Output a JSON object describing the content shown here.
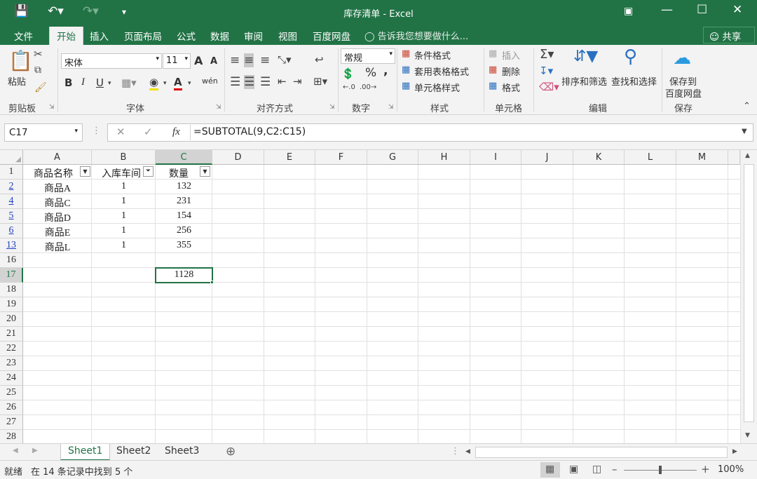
{
  "window": {
    "title": "库存清单 - Excel"
  },
  "ribbon_tabs": [
    "文件",
    "开始",
    "插入",
    "页面布局",
    "公式",
    "数据",
    "审阅",
    "视图",
    "百度网盘"
  ],
  "tell_me": "告诉我您想要做什么...",
  "share_label": "共享",
  "clipboard": {
    "paste": "粘贴",
    "group": "剪贴板"
  },
  "font": {
    "name": "宋体",
    "size": "11",
    "group": "字体",
    "bold": "B",
    "italic": "I",
    "underline": "U",
    "grow": "A",
    "shrink": "A",
    "wen": "wén"
  },
  "alignment": {
    "group": "对齐方式"
  },
  "number": {
    "format": "常规",
    "group": "数字",
    "percent": "%",
    "comma": ","
  },
  "styles": {
    "conditional": "条件格式",
    "table": "套用表格格式",
    "cell": "单元格样式",
    "group": "样式"
  },
  "cells": {
    "insert": "插入",
    "delete": "删除",
    "format": "格式",
    "group": "单元格"
  },
  "editing": {
    "sort": "排序和筛选",
    "find": "查找和选择",
    "group": "编辑"
  },
  "save_group": {
    "save": "保存到",
    "save2": "百度网盘",
    "group": "保存"
  },
  "formula_bar": {
    "name_box": "C17",
    "fx": "fx",
    "formula": "=SUBTOTAL(9,C2:C15)"
  },
  "columns": [
    "A",
    "B",
    "C",
    "D",
    "E",
    "F",
    "G",
    "H",
    "I",
    "J",
    "K",
    "L",
    "M"
  ],
  "rows": [
    "1",
    "2",
    "4",
    "5",
    "6",
    "13",
    "16",
    "17",
    "18",
    "19",
    "20",
    "21",
    "22",
    "23",
    "24",
    "25",
    "26",
    "27",
    "28"
  ],
  "headers": {
    "a": "商品名称",
    "b": "入库车间",
    "c": "数量"
  },
  "data_rows": [
    {
      "name": "商品A",
      "workshop": "1",
      "qty": "132"
    },
    {
      "name": "商品C",
      "workshop": "1",
      "qty": "231"
    },
    {
      "name": "商品D",
      "workshop": "1",
      "qty": "154"
    },
    {
      "name": "商品E",
      "workshop": "1",
      "qty": "256"
    },
    {
      "name": "商品L",
      "workshop": "1",
      "qty": "355"
    }
  ],
  "total": "1128",
  "sheets": [
    "Sheet1",
    "Sheet2",
    "Sheet3"
  ],
  "status": {
    "ready": "就绪",
    "filter_msg": "在 14 条记录中找到 5 个",
    "zoom": "100%"
  }
}
